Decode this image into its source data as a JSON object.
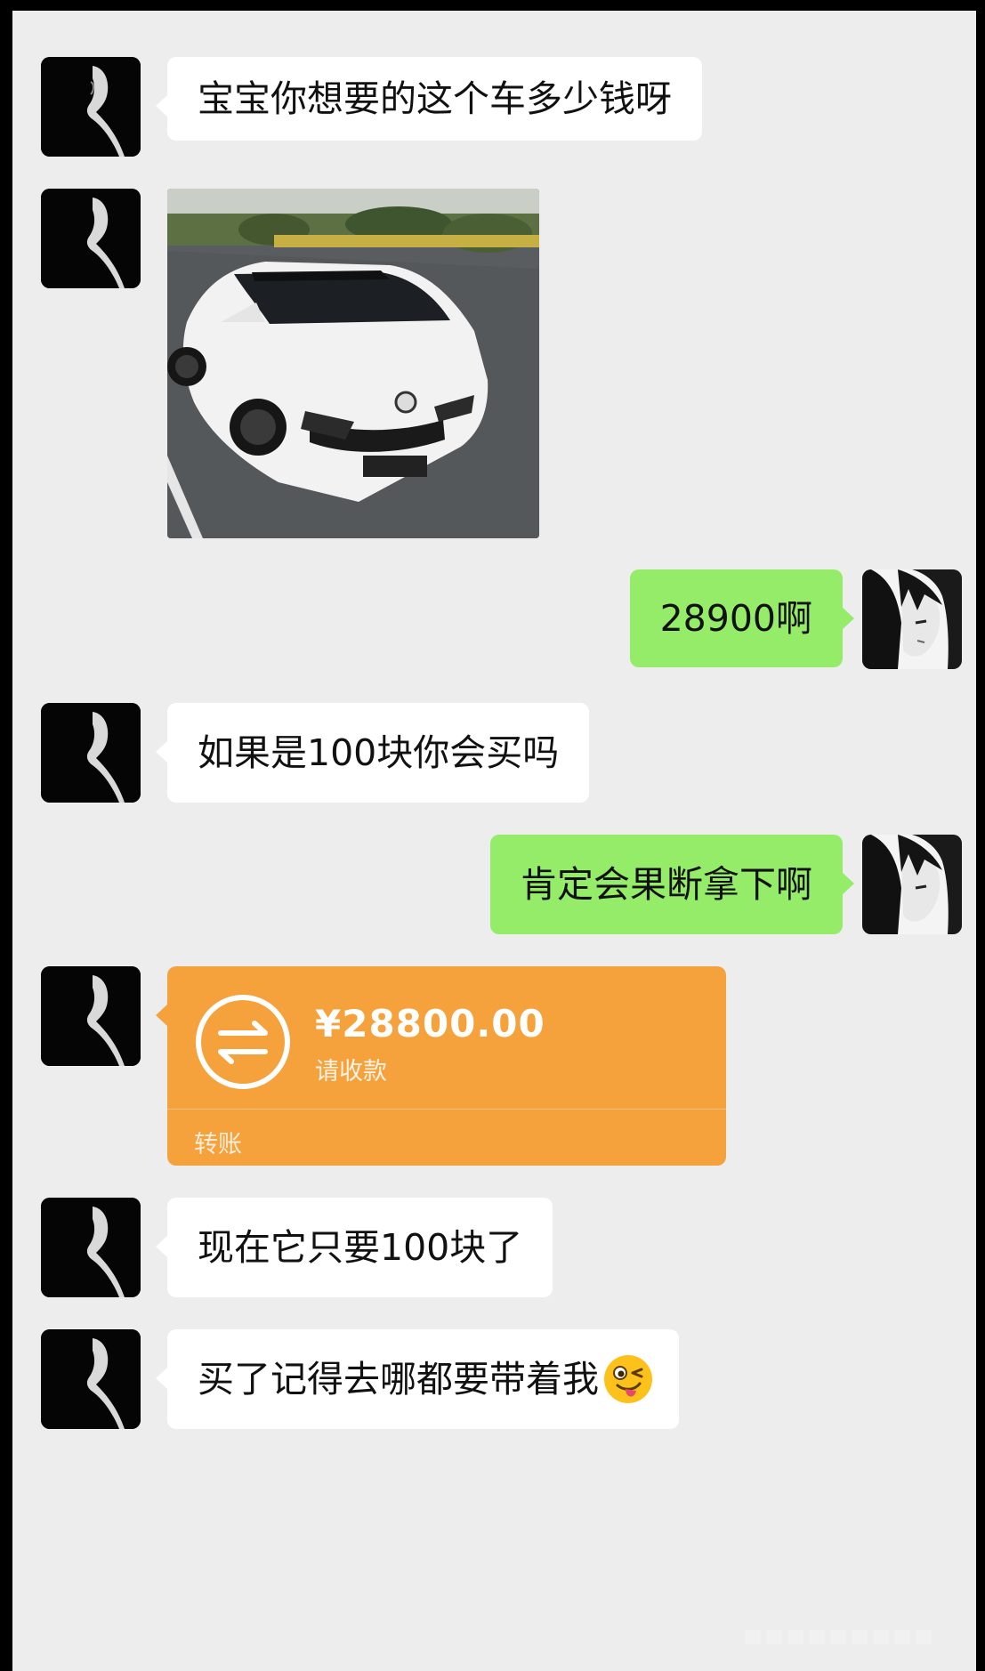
{
  "messages": [
    {
      "side": "in",
      "type": "text",
      "text": "宝宝你想要的这个车多少钱呀"
    },
    {
      "side": "in",
      "type": "image",
      "image": "white-hatchback-car-photo"
    },
    {
      "side": "out",
      "type": "text",
      "text": "28900啊"
    },
    {
      "side": "in",
      "type": "text",
      "text": "如果是100块你会买吗"
    },
    {
      "side": "out",
      "type": "text",
      "text": "肯定会果断拿下啊"
    },
    {
      "side": "in",
      "type": "transfer",
      "amount": "¥28800.00",
      "status": "请收款",
      "label": "转账"
    },
    {
      "side": "in",
      "type": "text",
      "text": "现在它只要100块了"
    },
    {
      "side": "in",
      "type": "text",
      "text": "买了记得去哪都要带着我",
      "emoji": "winking-tongue-emoji"
    }
  ],
  "colors": {
    "background": "#ededed",
    "incoming_bubble": "#ffffff",
    "outgoing_bubble": "#95ec69",
    "transfer_card": "#f6a23c"
  },
  "icons": {
    "avatar_in": "dark-silhouette-avatar",
    "avatar_out": "anime-portrait-avatar",
    "transfer": "transfer-arrows-icon"
  }
}
